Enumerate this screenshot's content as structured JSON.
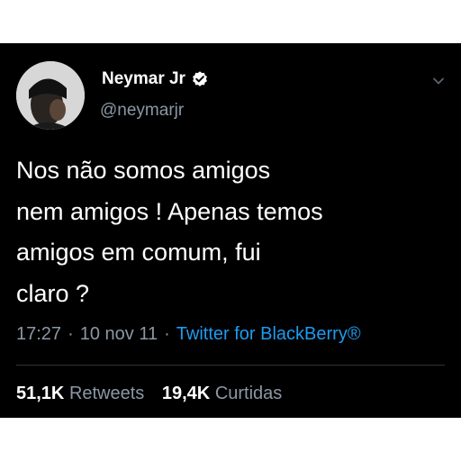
{
  "user": {
    "display_name": "Neymar Jr",
    "handle": "@neymarjr",
    "verified_icon": "verified-badge-icon",
    "avatar_icon": "profile-photo"
  },
  "tweet": {
    "lines": [
      "Nos não somos amigos",
      "nem amigos ! Apenas temos",
      "amigos em comum, fui",
      "claro ?"
    ]
  },
  "meta": {
    "time": "17:27",
    "separator": "·",
    "date": "10 nov 11",
    "source": "Twitter for BlackBerry®"
  },
  "stats": {
    "retweets_count": "51,1K",
    "retweets_label": "Retweets",
    "likes_count": "19,4K",
    "likes_label": "Curtidas"
  },
  "colors": {
    "background": "#000000",
    "text": "#ffffff",
    "secondary": "#8b98a5",
    "link": "#1d9bf0"
  }
}
